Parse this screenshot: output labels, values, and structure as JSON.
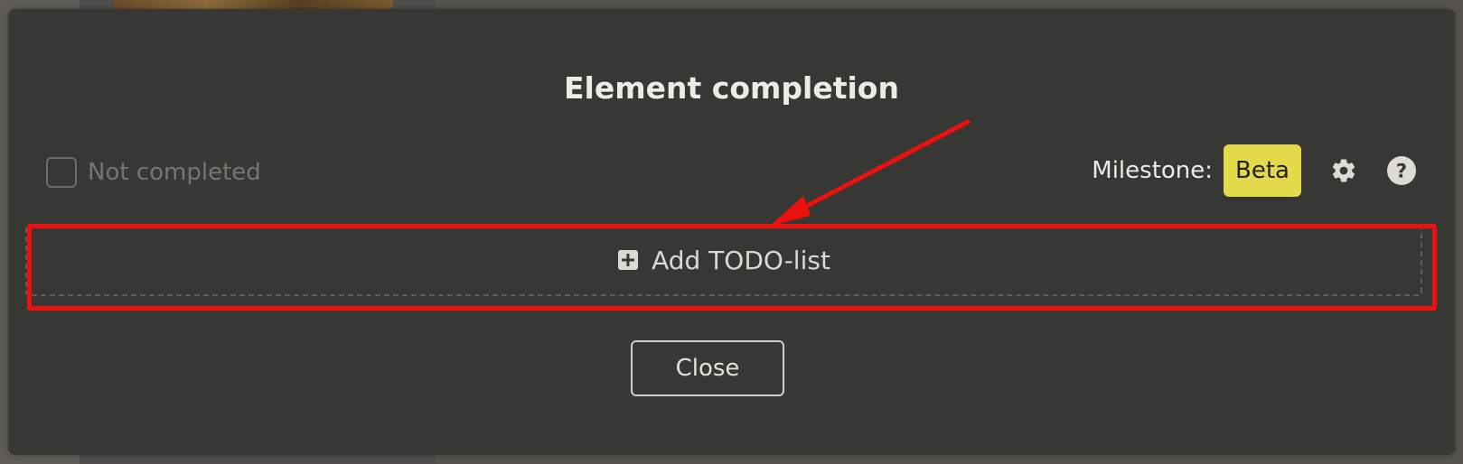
{
  "dialog": {
    "title": "Element completion",
    "status": {
      "label": "Not completed",
      "checked": false
    },
    "milestone": {
      "label": "Milestone:",
      "value": "Beta",
      "badge_color": "#e4d94b"
    },
    "icons": {
      "settings": "gear-icon",
      "help": "help-circle-icon",
      "add": "plus-square-icon"
    },
    "add_todo": {
      "label": "Add TODO-list"
    },
    "close_button": {
      "label": "Close"
    }
  },
  "annotation": {
    "highlight_color": "#ee0f0f"
  }
}
